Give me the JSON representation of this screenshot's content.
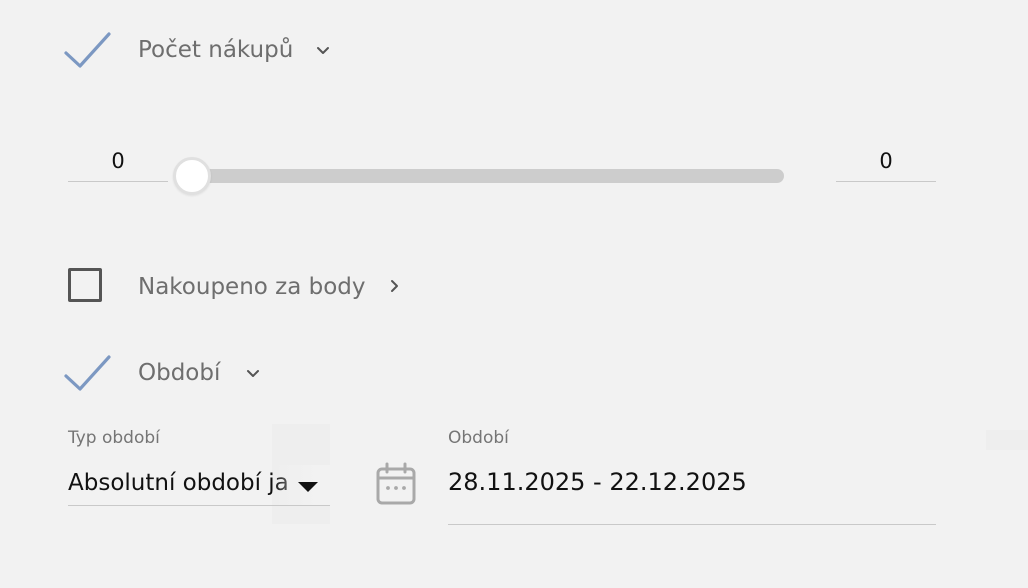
{
  "colors": {
    "accent": "#7c98c2",
    "background": "#f2f2f2",
    "label_gray": "#6e6e6e",
    "track": "#cdcdcd"
  },
  "filters": {
    "purchase_count": {
      "label": "Počet nákupů",
      "checked": true,
      "expanded": true,
      "expand_icon": "chevron-down-icon",
      "min_value": "0",
      "max_value": "0",
      "slider_level": 0
    },
    "bought_for_points": {
      "label": "Nakoupeno za body",
      "checked": false,
      "expanded": false,
      "expand_icon": "chevron-right-icon"
    },
    "period": {
      "label": "Období",
      "checked": true,
      "expanded": true,
      "expand_icon": "chevron-down-icon",
      "type_label": "Typ období",
      "type_value": "Absolutní období ja",
      "range_label": "Období",
      "range_value": "28.11.2025 - 22.12.2025",
      "calendar_icon": "calendar-icon"
    }
  }
}
